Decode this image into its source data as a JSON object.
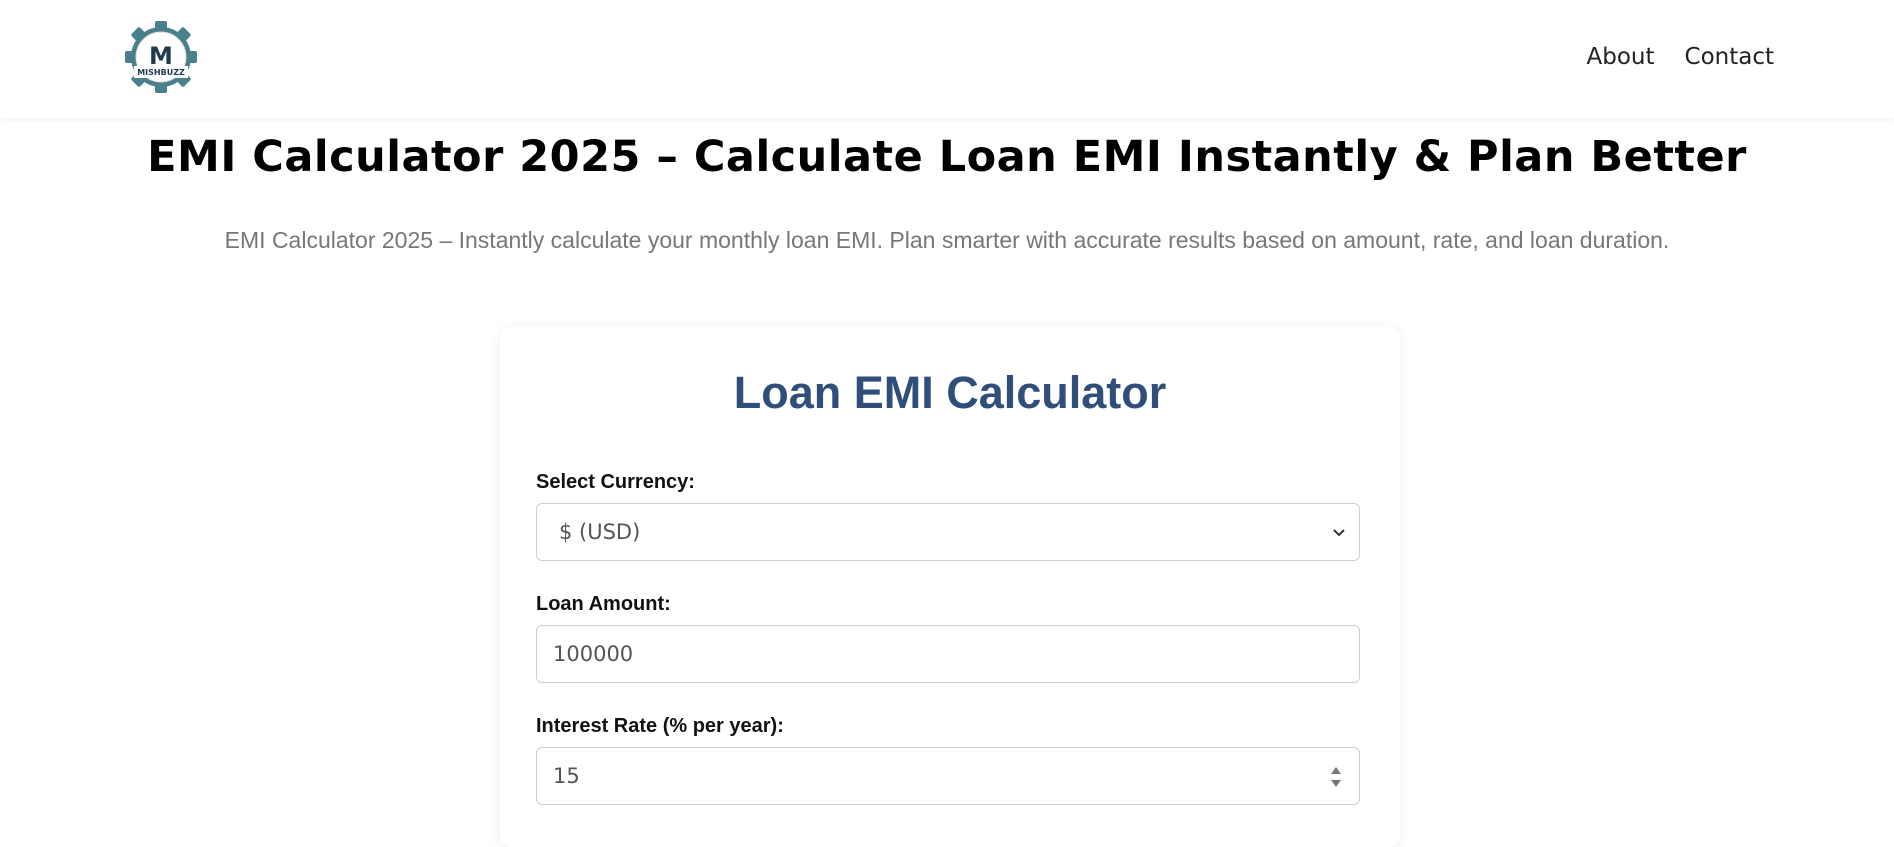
{
  "header": {
    "logo_text": "M",
    "logo_subtext": "MISHBUZZ",
    "nav": [
      "About",
      "Contact"
    ]
  },
  "page": {
    "title": "EMI Calculator 2025 – Calculate Loan EMI Instantly & Plan Better",
    "subtitle": "EMI Calculator 2025 – Instantly calculate your monthly loan EMI. Plan smarter with accurate results based on amount, rate, and loan duration."
  },
  "calculator": {
    "title": "Loan EMI Calculator",
    "currency": {
      "label": "Select Currency:",
      "value": "$ (USD)"
    },
    "loan_amount": {
      "label": "Loan Amount:",
      "value": "100000"
    },
    "interest_rate": {
      "label": "Interest Rate (% per year):",
      "value": "15"
    }
  },
  "colors": {
    "title": "#2f4f7a",
    "logo_teal": "#4a7f8c"
  }
}
